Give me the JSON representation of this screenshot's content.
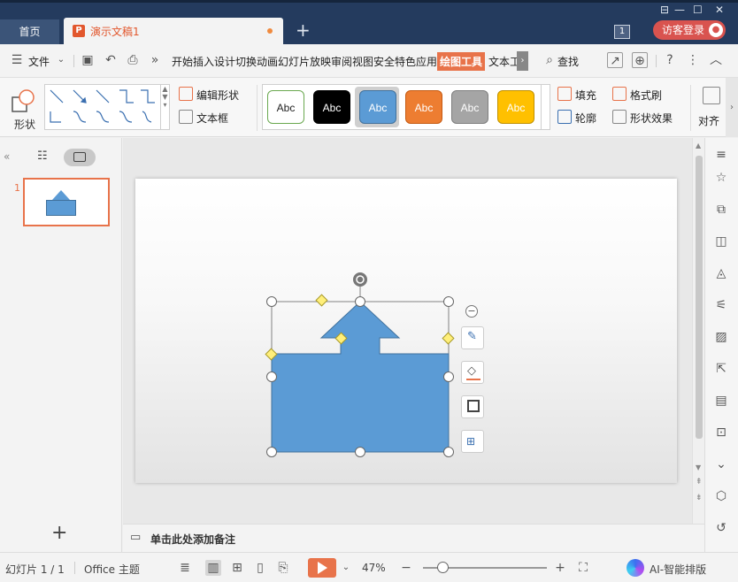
{
  "window": {
    "home_tab": "首页",
    "doc_tab": "演示文稿1",
    "window_count": "1",
    "login_button": "访客登录"
  },
  "menu": {
    "file": "文件",
    "items": [
      "开始",
      "插入",
      "设计",
      "切换",
      "动画",
      "幻灯片放映",
      "审阅",
      "视图",
      "安全",
      "特色应用"
    ],
    "active": "绘图工具",
    "text_tools": "文本工",
    "search": "查找"
  },
  "ribbon": {
    "shape_label": "形状",
    "edit_shape": "编辑形状",
    "text_box": "文本框",
    "style_presets": [
      {
        "label": "Abc",
        "bg": "#ffffff",
        "fg": "#222222",
        "border": "#6aa84f"
      },
      {
        "label": "Abc",
        "bg": "#000000",
        "fg": "#ffffff",
        "border": "#000000"
      },
      {
        "label": "Abc",
        "bg": "#5b9bd5",
        "fg": "#ffffff",
        "border": "#41719c"
      },
      {
        "label": "Abc",
        "bg": "#ed7d31",
        "fg": "#ffffff",
        "border": "#c55a11"
      },
      {
        "label": "Abc",
        "bg": "#a5a5a5",
        "fg": "#ffffff",
        "border": "#7f7f7f"
      },
      {
        "label": "Abc",
        "bg": "#ffc000",
        "fg": "#ffffff",
        "border": "#c09000"
      }
    ],
    "selected_style_index": 2,
    "fill": "填充",
    "format_painter": "格式刷",
    "outline": "轮廓",
    "shape_effects": "形状效果",
    "align": "对齐"
  },
  "slides": {
    "current_number": "1"
  },
  "notes": {
    "placeholder": "单击此处添加备注"
  },
  "status": {
    "slide_counter": "幻灯片 1 / 1",
    "theme": "Office 主题",
    "zoom": "47%",
    "ai_layout": "AI-智能排版",
    "zoom_fraction": 0.16
  },
  "colors": {
    "accent": "#e8734a",
    "title_bar": "#243b5e",
    "shape_fill": "#5b9bd5",
    "shape_border": "#41719c"
  }
}
